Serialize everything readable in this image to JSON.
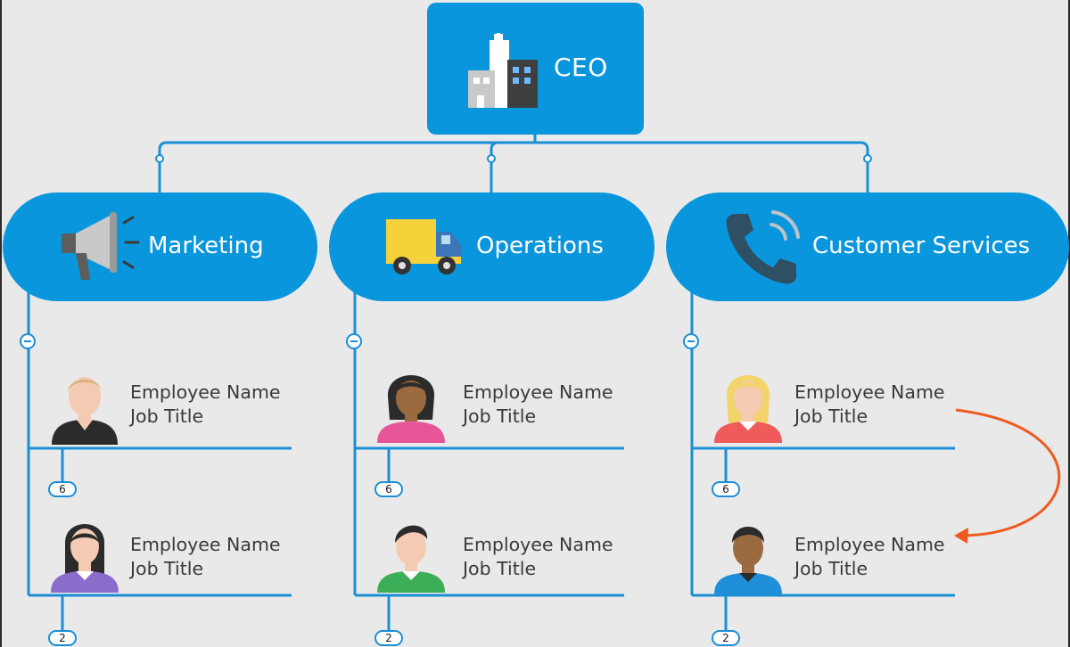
{
  "ceo": {
    "label": "CEO",
    "icon": "office-buildings-icon"
  },
  "departments": [
    {
      "key": "marketing",
      "label": "Marketing",
      "icon": "megaphone-icon",
      "employees": [
        {
          "name": "Employee Name",
          "title": "Job Title",
          "badge": "6"
        },
        {
          "name": "Employee Name",
          "title": "Job Title",
          "badge": "2"
        }
      ]
    },
    {
      "key": "operations",
      "label": "Operations",
      "icon": "delivery-truck-icon",
      "employees": [
        {
          "name": "Employee Name",
          "title": "Job Title",
          "badge": "6"
        },
        {
          "name": "Employee Name",
          "title": "Job Title",
          "badge": "2"
        }
      ]
    },
    {
      "key": "customer-services",
      "label": "Customer Services",
      "icon": "phone-icon",
      "employees": [
        {
          "name": "Employee Name",
          "title": "Job Title",
          "badge": "6"
        },
        {
          "name": "Employee Name",
          "title": "Job Title",
          "badge": "2"
        }
      ]
    }
  ],
  "colors": {
    "background": "#e9e9e9",
    "node_fill": "#0a96dc",
    "connector": "#1a8fd6",
    "text": "#3a3a3a",
    "arrow": "#f05a1e"
  }
}
